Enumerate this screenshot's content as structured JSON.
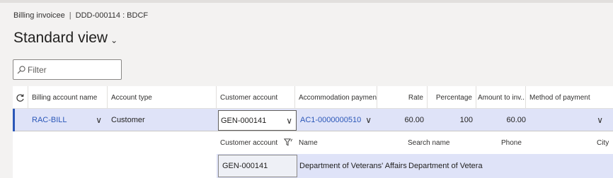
{
  "breadcrumb": {
    "module": "Billing invoicee",
    "separator": "|",
    "record": "DDD-000114 : BDCF"
  },
  "view": {
    "title": "Standard view",
    "chevron": "⌄"
  },
  "filter": {
    "placeholder": "Filter"
  },
  "grid": {
    "columns": [
      "Billing account name",
      "Account type",
      "Customer account",
      "Accommodation payment...",
      "Rate",
      "Percentage",
      "Amount to inv...",
      "Method of payment"
    ],
    "row": {
      "billing_account_name": "RAC-BILL",
      "account_type": "Customer",
      "customer_account": "GEN-000141",
      "accommodation_payment": "AC1-0000000510",
      "rate": "60.00",
      "percentage": "100",
      "amount_to_invoice": "60.00",
      "method_of_payment": ""
    }
  },
  "lookup": {
    "columns": [
      "Customer account",
      "Name",
      "Search name",
      "Phone",
      "City"
    ],
    "row": {
      "customer_account": "GEN-000141",
      "name": "Department of Veterans' Affairs",
      "search_name": "Department of Vetera",
      "phone": "",
      "city": ""
    }
  },
  "icons": {
    "refresh": "refresh-icon",
    "search": "search-icon",
    "filter": "filter-icon",
    "chevron": "chevron-down-icon"
  },
  "colors": {
    "accent": "#2b57b8",
    "selected_row": "#dfe3f8"
  }
}
